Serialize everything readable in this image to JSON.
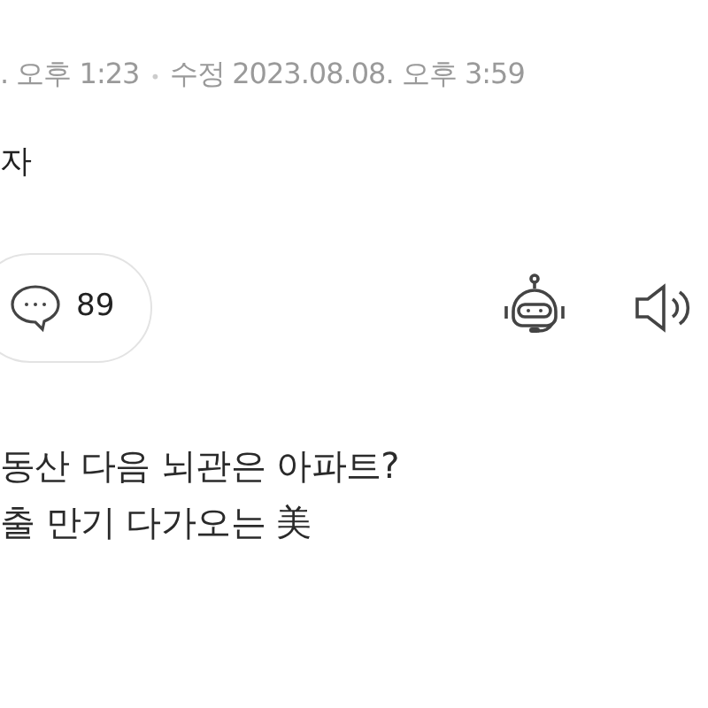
{
  "meta": {
    "published": ". 오후 1:23",
    "separator": "•",
    "modified_label": "수정",
    "modified": "2023.08.08. 오후 3:59"
  },
  "byline": "자",
  "toolbar": {
    "comment_count": "89"
  },
  "subheadlines": [
    "동산 다음 뇌관은 아파트?",
    "출 만기 다가오는 美"
  ]
}
